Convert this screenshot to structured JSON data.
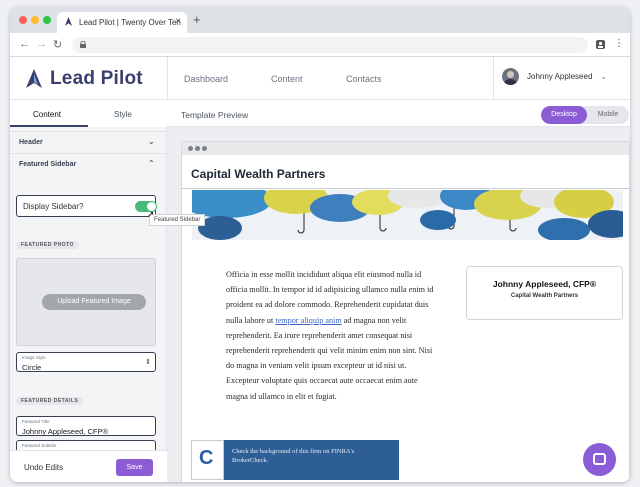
{
  "browser": {
    "tab_title": "Lead Pilot | Twenty Over Ten",
    "tab_close": "×",
    "new_tab": "+"
  },
  "app": {
    "brand": "Lead Pilot",
    "nav": [
      "Dashboard",
      "Content",
      "Contacts"
    ],
    "user_name": "Johnny Appleseed",
    "accent_color": "#8b5cd6",
    "brand_color": "#3b3f6b"
  },
  "sidebar": {
    "tabs": [
      "Content",
      "Style"
    ],
    "active_tab": "Content",
    "sections": [
      "Header",
      "Featured Sidebar"
    ],
    "display_sidebar_label": "Display Sidebar?",
    "display_sidebar_on": true,
    "tooltip": "Featured Sidebar",
    "featured_photo_chip": "FEATURED PHOTO",
    "upload_button": "Upload Featured Image",
    "image_style_label": "Image Style",
    "image_style_value": "Circle",
    "featured_details_chip": "FEATURED DETAILS",
    "featured_title_label": "Featured Title",
    "featured_title_value": "Johnny Appleseed, CFP®",
    "featured_subtitle_label": "Featured Subtitle",
    "undo": "Undo Edits",
    "save": "Save"
  },
  "main": {
    "title": "Template Preview",
    "device_options": [
      "Desktop",
      "Mobile"
    ],
    "active_device": "Desktop"
  },
  "preview": {
    "firm_name": "Capital Wealth Partners",
    "body_before_link": "Officia in esse mollit incididunt aliqua elit eiusmod nulla id officia mollit. In tempor id id adipisicing ullamco nulla enim id proident ea ad dolore commodo. Reprehenderit cupidatat duis nulla labore ut ",
    "body_link": "tempor aliquip anim",
    "body_after_link": " ad magna non velit reprehenderit. Ea irure reprehenderit amet consequat nisi reprehenderit reprehenderit qui velit minim enim non sint. Nisi do magna in veniam velit ipsum excepteur ut id nisi ut. Excepteur voluptate quis occaecat aute occaecat enim aute magna id ullamco in elit et fugiat.",
    "card_name": "Johnny Appleseed, CFP®",
    "card_company": "Capital Wealth Partners",
    "brokercheck_text": "Check the background of this firm on FINRA's BrokerCheck."
  }
}
